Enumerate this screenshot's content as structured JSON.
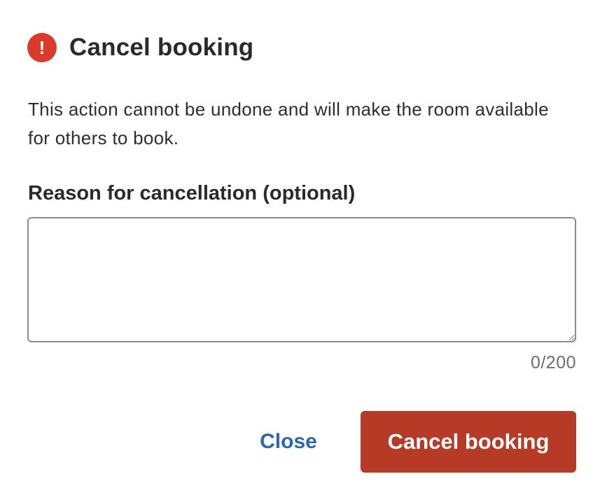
{
  "dialog": {
    "icon": "alert-circle-icon",
    "icon_glyph": "!",
    "title": "Cancel booking",
    "message": "This action cannot be undone and will make the room available for others to book."
  },
  "reason_field": {
    "label": "Reason for cancellation (optional)",
    "value": "",
    "placeholder": "",
    "char_count": "0/200"
  },
  "actions": {
    "close_label": "Close",
    "confirm_label": "Cancel booking"
  },
  "colors": {
    "danger": "#d93a2b",
    "confirm_button": "#b73a24",
    "link_blue": "#2a66b8",
    "muted_text": "#6b6b7b"
  }
}
